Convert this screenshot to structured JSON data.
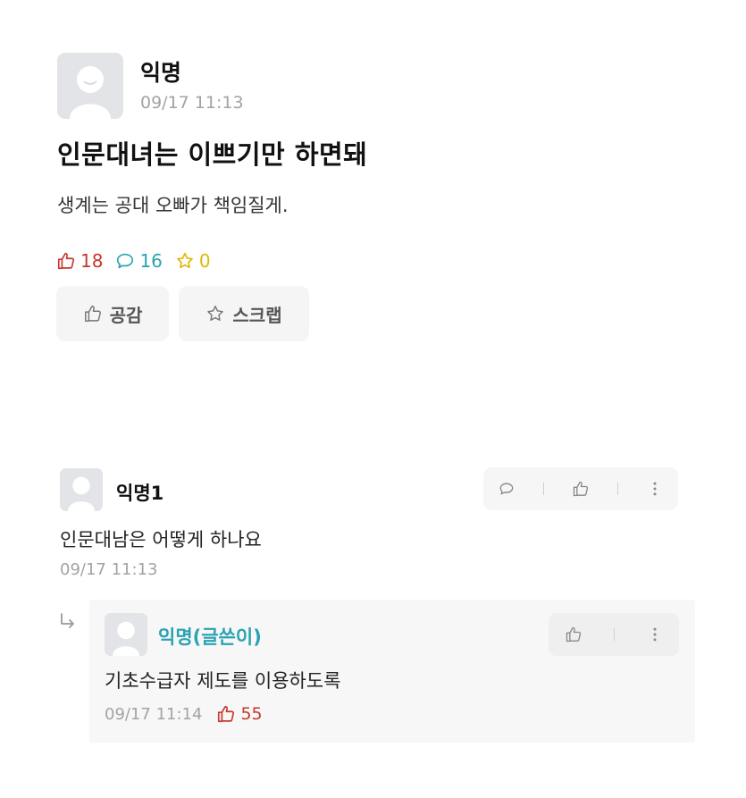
{
  "post": {
    "author": "익명",
    "time": "09/17 11:13",
    "title": "인문대녀는 이쁘기만 하면돼",
    "body": "생계는 공대 오빠가 책임질게.",
    "stats": {
      "likes": "18",
      "comments": "16",
      "scraps": "0"
    },
    "buttons": {
      "like": "공감",
      "scrap": "스크랩"
    }
  },
  "comment": {
    "author": "익명1",
    "text": "인문대남은 어떻게 하나요",
    "time": "09/17 11:13"
  },
  "reply": {
    "author": "익명(글쓴이)",
    "text": "기초수급자 제도를 이용하도록",
    "time": "09/17 11:14",
    "likes": "55"
  },
  "colors": {
    "like": "#c8372d",
    "comment": "#2aa3b3",
    "scrap": "#e1b700",
    "author_badge": "#2aa3b3"
  },
  "icons": [
    "avatar-icon",
    "thumb-up-icon",
    "comment-bubble-icon",
    "star-icon",
    "more-vertical-icon",
    "reply-arrow-icon"
  ]
}
